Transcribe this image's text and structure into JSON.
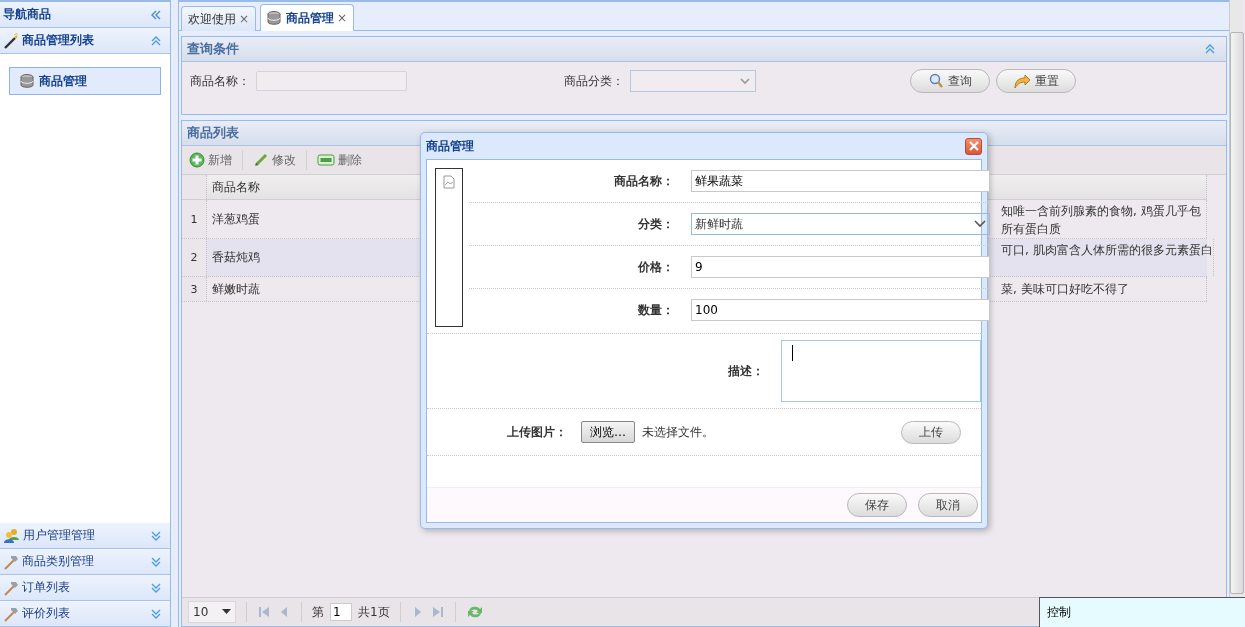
{
  "sidebar": {
    "title": "导航商品",
    "sections": [
      {
        "label": "商品管理列表",
        "kind": "wand",
        "expanded": true,
        "items": [
          {
            "label": "商品管理",
            "selected": true
          }
        ]
      },
      {
        "label": "用户管理管理",
        "kind": "users",
        "expanded": false
      },
      {
        "label": "商品类别管理",
        "kind": "hammer",
        "expanded": false
      },
      {
        "label": "订单列表",
        "kind": "hammer",
        "expanded": false
      },
      {
        "label": "评价列表",
        "kind": "hammer",
        "expanded": false
      }
    ]
  },
  "tabs": [
    {
      "label": "欢迎使用",
      "kind": "plain",
      "selected": false,
      "close": "×"
    },
    {
      "label": "商品管理",
      "kind": "module",
      "selected": true,
      "close": "×"
    }
  ],
  "query_panel": {
    "title": "查询条件",
    "name_label": "商品名称：",
    "category_label": "商品分类：",
    "buttons": [
      {
        "label": "查询",
        "kind": "search"
      },
      {
        "label": "重置",
        "kind": "reset"
      }
    ]
  },
  "list_panel": {
    "title": "商品列表",
    "toolbar": [
      {
        "label": "新增",
        "kind": "add"
      },
      {
        "label": "修改",
        "kind": "edit"
      },
      {
        "label": "删除",
        "kind": "remove"
      }
    ],
    "columns": [
      "商品名称"
    ],
    "rows": [
      {
        "index": "1",
        "name": "洋葱鸡蛋",
        "description": [
          "知唯一含前列腺素的食物, 鸡蛋几乎包",
          "所有蛋白质"
        ]
      },
      {
        "index": "2",
        "name": "香菇炖鸡",
        "description": [
          "可口, 肌肉富含人体所需的很多元素蛋白"
        ]
      },
      {
        "index": "3",
        "name": "鲜嫩时蔬",
        "description": [
          "菜, 美味可口好吃不得了"
        ]
      }
    ],
    "pager": {
      "page_size": "10",
      "page_prefix": "第",
      "page": "1",
      "page_total": "共1页"
    }
  },
  "dialog": {
    "title": "商品管理",
    "fields": [
      {
        "label": "商品名称：",
        "kind": "text",
        "value": "鲜果蔬菜"
      },
      {
        "label": "分类：",
        "kind": "select",
        "value": "新鲜时蔬"
      },
      {
        "label": "价格：",
        "kind": "text",
        "value": "9"
      },
      {
        "label": "数量：",
        "kind": "text",
        "value": "100"
      },
      {
        "label": "描述：",
        "kind": "textarea"
      }
    ],
    "upload": {
      "label": "上传图片：",
      "browse": "浏览…",
      "status": "未选择文件。",
      "button": "上传"
    },
    "buttons": [
      "保存",
      "取消"
    ]
  },
  "popup": {
    "title": "控制"
  }
}
